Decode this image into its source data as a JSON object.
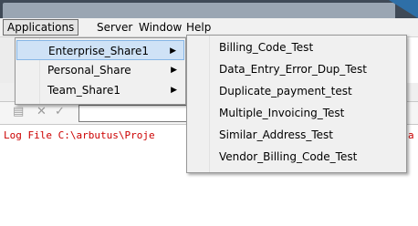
{
  "menubar": {
    "items": [
      "Applications",
      "Server",
      "Window",
      "Help"
    ]
  },
  "submenu_apps": {
    "items": [
      {
        "label": "Enterprise_Share1",
        "arrow": "▶"
      },
      {
        "label": "Personal_Share",
        "arrow": "▶"
      },
      {
        "label": "Team_Share1",
        "arrow": "▶"
      }
    ]
  },
  "submenu_enterprise": {
    "items": [
      "Billing_Code_Test",
      "Data_Entry_Error_Dup_Test",
      "Duplicate_payment_test",
      "Multiple_Invoicing_Test",
      "Similar_Address_Test",
      "Vendor_Billing_Code_Test"
    ]
  },
  "toolbar": {
    "cancel_icon": "✕",
    "accept_icon": "✓"
  },
  "log": {
    "text": "Log File C:\\arbutus\\Proje",
    "right_fragment": "a"
  },
  "colors": {
    "accent": "#2e6fa7",
    "highlight": "#cfe2f6",
    "log_text": "#cc0000"
  }
}
